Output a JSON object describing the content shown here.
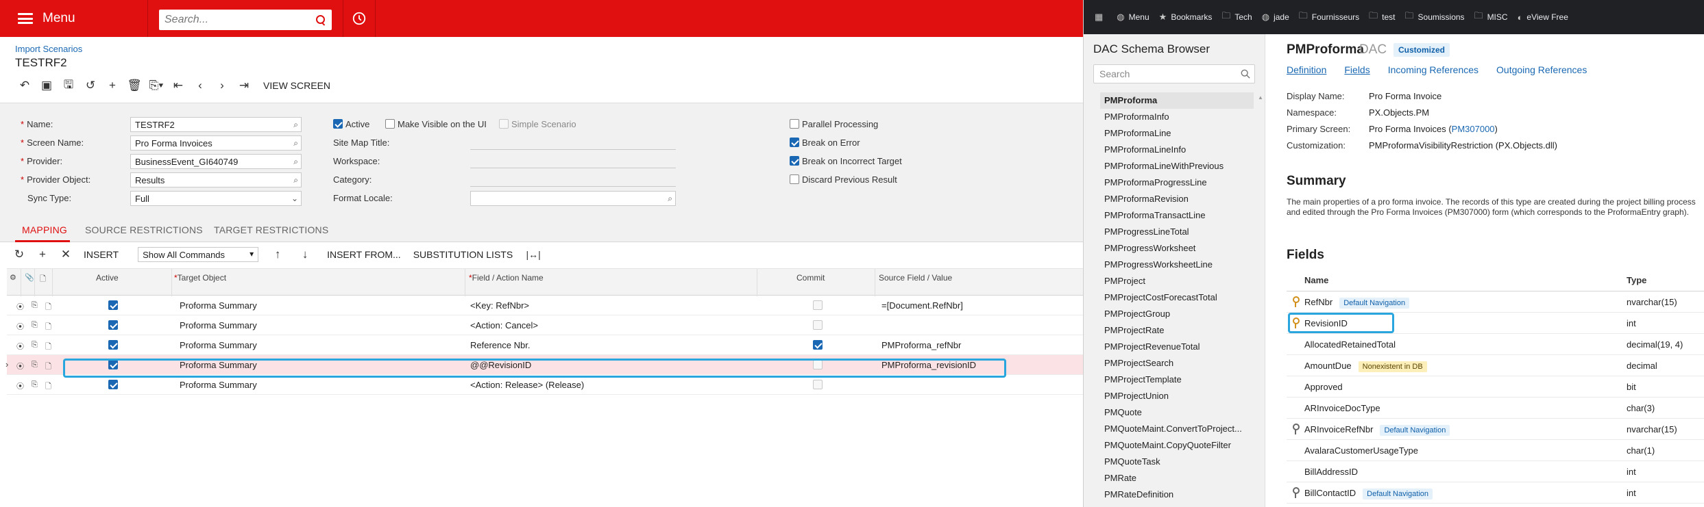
{
  "topbar": {
    "menu_label": "Menu",
    "search_placeholder": "Search..."
  },
  "breadcrumb": "Import Scenarios",
  "screen_title": "TESTRF2",
  "toolbar": {
    "view_screen": "VIEW SCREEN"
  },
  "form": {
    "name_label": "Name:",
    "name_value": "TESTRF2",
    "screen_label": "Screen Name:",
    "screen_value": "Pro Forma Invoices",
    "provider_label": "Provider:",
    "provider_value": "BusinessEvent_GI640749",
    "provider_object_label": "Provider Object:",
    "provider_object_value": "Results",
    "sync_label": "Sync Type:",
    "sync_value": "Full",
    "active_label": "Active",
    "make_visible_label": "Make Visible on the UI",
    "simple_label": "Simple Scenario",
    "site_map_label": "Site Map Title:",
    "workspace_label": "Workspace:",
    "category_label": "Category:",
    "format_locale_label": "Format Locale:",
    "parallel_label": "Parallel Processing",
    "break_error_label": "Break on Error",
    "break_target_label": "Break on Incorrect Target",
    "discard_label": "Discard Previous Result"
  },
  "tabs": [
    "MAPPING",
    "SOURCE RESTRICTIONS",
    "TARGET RESTRICTIONS"
  ],
  "grid_toolbar": {
    "insert": "INSERT",
    "commands_select": "Show All Commands",
    "insert_from": "INSERT FROM...",
    "substitution": "SUBSTITUTION LISTS"
  },
  "grid": {
    "headers": {
      "active": "Active",
      "target": "Target Object",
      "field": "Field / Action Name",
      "commit": "Commit",
      "source": "Source Field / Value"
    },
    "rows": [
      {
        "active": true,
        "target": "Proforma Summary",
        "field": "<Key: RefNbr>",
        "commit": false,
        "source": "=[Document.RefNbr]"
      },
      {
        "active": true,
        "target": "Proforma Summary",
        "field": "<Action: Cancel>",
        "commit": false,
        "source": ""
      },
      {
        "active": true,
        "target": "Proforma Summary",
        "field": "Reference Nbr.",
        "commit": true,
        "source": "PMProforma_refNbr"
      },
      {
        "active": true,
        "target": "Proforma Summary",
        "field": "@@RevisionID",
        "commit": false,
        "source": "PMProforma_revisionID",
        "selected": true
      },
      {
        "active": true,
        "target": "Proforma Summary",
        "field": "<Action: Release> (Release)",
        "commit": false,
        "source": ""
      }
    ]
  },
  "bookmarks": [
    {
      "icon": "globe-icon",
      "label": "Menu"
    },
    {
      "icon": "star-icon",
      "label": "Bookmarks"
    },
    {
      "icon": "folder-icon",
      "label": "Tech"
    },
    {
      "icon": "globe-icon",
      "label": "jade"
    },
    {
      "icon": "folder-icon",
      "label": "Fournisseurs"
    },
    {
      "icon": "folder-icon",
      "label": "test"
    },
    {
      "icon": "folder-icon",
      "label": "Soumissions"
    },
    {
      "icon": "folder-icon",
      "label": "MISC"
    },
    {
      "icon": "eview-icon",
      "label": "eView Free"
    }
  ],
  "dac": {
    "browser_title": "DAC Schema Browser",
    "search_placeholder": "Search",
    "list": [
      "PMProforma",
      "PMProformaInfo",
      "PMProformaLine",
      "PMProformaLineInfo",
      "PMProformaLineWithPrevious",
      "PMProformaProgressLine",
      "PMProformaRevision",
      "PMProformaTransactLine",
      "PMProgressLineTotal",
      "PMProgressWorksheet",
      "PMProgressWorksheetLine",
      "PMProject",
      "PMProjectCostForecastTotal",
      "PMProjectGroup",
      "PMProjectRate",
      "PMProjectRevenueTotal",
      "PMProjectSearch",
      "PMProjectTemplate",
      "PMProjectUnion",
      "PMQuote",
      "PMQuoteMaint.ConvertToProject...",
      "PMQuoteMaint.CopyQuoteFilter",
      "PMQuoteTask",
      "PMRate",
      "PMRateDefinition"
    ],
    "title": "PMProforma",
    "title_suffix": "DAC",
    "badge": "Customized",
    "links": [
      "Definition",
      "Fields",
      "Incoming References",
      "Outgoing References"
    ],
    "info": {
      "display_name_label": "Display Name:",
      "display_name": "Pro Forma Invoice",
      "namespace_label": "Namespace:",
      "namespace": "PX.Objects.PM",
      "primary_screen_label": "Primary Screen:",
      "primary_screen": "Pro Forma Invoices (",
      "primary_screen_link": "PM307000",
      "primary_screen_end": ")",
      "customization_label": "Customization:",
      "customization": "PMProformaVisibilityRestriction (PX.Objects.dll)"
    },
    "summary_title": "Summary",
    "summary_text": "The main properties of a pro forma invoice. The records of this type are created during the project billing process and edited through the Pro Forma Invoices (PM307000) form (which corresponds to the ProformaEntry graph).",
    "fields_title": "Fields",
    "fields_headers": {
      "name": "Name",
      "type": "Type"
    },
    "fields": [
      {
        "name": "RefNbr",
        "tag": "Default Navigation",
        "tag_color": "blue",
        "key": "gold",
        "type": "nvarchar(15)"
      },
      {
        "name": "RevisionID",
        "tag": "",
        "tag_color": "",
        "key": "gold",
        "type": "int"
      },
      {
        "name": "AllocatedRetainedTotal",
        "tag": "",
        "tag_color": "",
        "key": "",
        "type": "decimal(19, 4)"
      },
      {
        "name": "AmountDue",
        "tag": "Nonexistent in DB",
        "tag_color": "yellow",
        "key": "",
        "type": "decimal"
      },
      {
        "name": "Approved",
        "tag": "",
        "tag_color": "",
        "key": "",
        "type": "bit"
      },
      {
        "name": "ARInvoiceDocType",
        "tag": "",
        "tag_color": "",
        "key": "",
        "type": "char(3)"
      },
      {
        "name": "ARInvoiceRefNbr",
        "tag": "Default Navigation",
        "tag_color": "blue",
        "key": "grey",
        "type": "nvarchar(15)"
      },
      {
        "name": "AvalaraCustomerUsageType",
        "tag": "",
        "tag_color": "",
        "key": "",
        "type": "char(1)"
      },
      {
        "name": "BillAddressID",
        "tag": "",
        "tag_color": "",
        "key": "",
        "type": "int"
      },
      {
        "name": "BillContactID",
        "tag": "Default Navigation",
        "tag_color": "blue",
        "key": "grey",
        "type": "int"
      }
    ]
  }
}
